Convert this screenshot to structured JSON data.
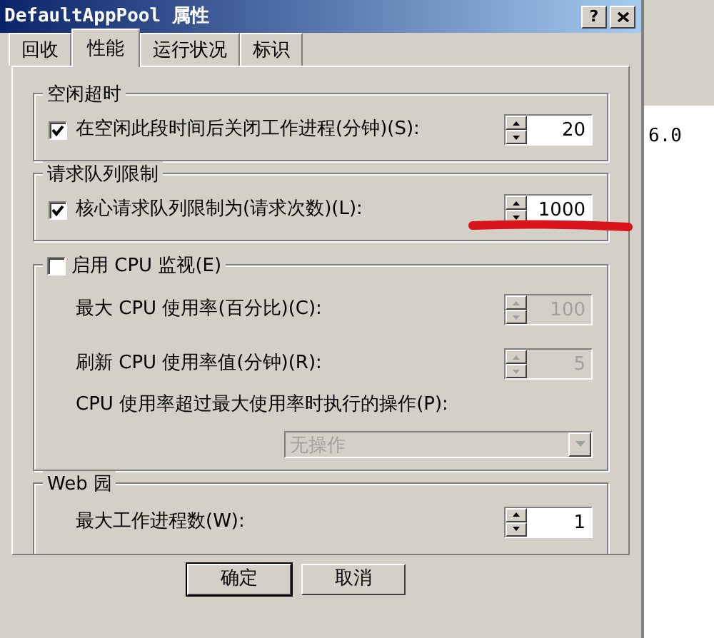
{
  "window": {
    "title": "DefaultAppPool 属性",
    "controls": [
      {
        "kind": "help",
        "label": "?"
      },
      {
        "kind": "close"
      }
    ]
  },
  "tabs": [
    {
      "label": "回收",
      "selected": false
    },
    {
      "label": "性能",
      "selected": true
    },
    {
      "label": "运行状况",
      "selected": false
    },
    {
      "label": "标识",
      "selected": false
    }
  ],
  "groups": [
    {
      "kind": "plain",
      "title": "空闲超时",
      "rows": [
        {
          "kind": "check-spin",
          "label": "在空闲此段时间后关闭工作进程(分钟)(S):",
          "checked": true,
          "value": "20",
          "disabled": false
        }
      ]
    },
    {
      "kind": "plain",
      "title": "请求队列限制",
      "rows": [
        {
          "kind": "check-spin",
          "label": "核心请求队列限制为(请求次数)(L):",
          "checked": true,
          "value": "1000",
          "disabled": false
        }
      ]
    },
    {
      "kind": "check",
      "title": "启用 CPU 监视(E)",
      "checked": false,
      "rows": [
        {
          "kind": "spin",
          "label": "最大 CPU 使用率(百分比)(C):",
          "value": "100",
          "disabled": true
        },
        {
          "kind": "spin",
          "label": "刷新 CPU 使用率值(分钟)(R):",
          "value": "5",
          "disabled": true
        },
        {
          "kind": "select",
          "label": "CPU 使用率超过最大使用率时执行的操作(P):",
          "value": "无操作",
          "disabled": true
        }
      ]
    },
    {
      "kind": "plain",
      "title": "Web 园",
      "rows": [
        {
          "kind": "spin",
          "label": "最大工作进程数(W):",
          "value": "1",
          "disabled": false
        }
      ]
    }
  ],
  "buttons": [
    "确定",
    "取消"
  ],
  "background_window": {
    "text": "6.0"
  }
}
